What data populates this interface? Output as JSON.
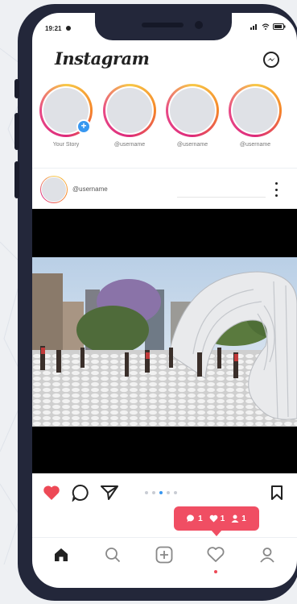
{
  "status_bar": {
    "time": "19:21"
  },
  "header": {
    "logo": "Instagram",
    "messenger_icon": "messenger-icon"
  },
  "stories": [
    {
      "label": "Your Story",
      "has_add": true
    },
    {
      "label": "@username"
    },
    {
      "label": "@username"
    },
    {
      "label": "@username"
    }
  ],
  "post": {
    "username": "@username",
    "more_icon": "more-vertical-icon",
    "carousel_pages": 5,
    "carousel_active": 3
  },
  "actions": {
    "like_icon": "heart-filled-icon",
    "comment_icon": "comment-icon",
    "share_icon": "send-icon",
    "save_icon": "bookmark-icon"
  },
  "notification": {
    "comments": "1",
    "likes": "1",
    "followers": "1",
    "color": "#f04e63"
  },
  "tabbar": [
    "home-icon",
    "search-icon",
    "add-icon",
    "heart-icon",
    "profile-icon"
  ],
  "colors": {
    "accent": "#3897f0",
    "like": "#ed4956",
    "phone_frame": "#23273a"
  }
}
